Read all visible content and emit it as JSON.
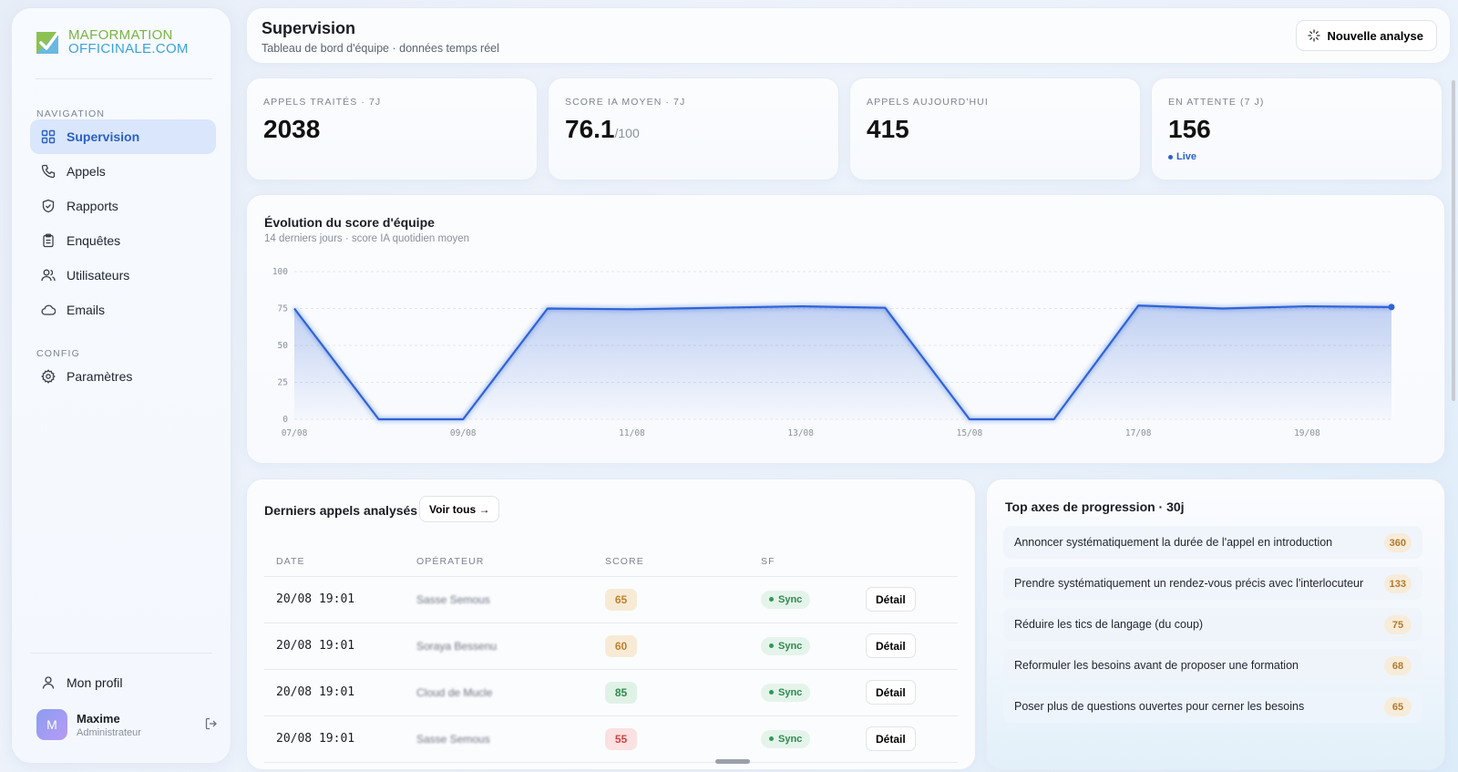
{
  "sidebar": {
    "logo": {
      "line1": "MAFORMATION",
      "line2": "OFFICINALE.COM"
    },
    "nav_section": "NAVIGATION",
    "config_section": "CONFIG",
    "items": [
      {
        "label": "Supervision",
        "icon": "grid-icon"
      },
      {
        "label": "Appels",
        "icon": "phone-icon"
      },
      {
        "label": "Rapports",
        "icon": "shield-icon"
      },
      {
        "label": "Enquêtes",
        "icon": "clipboard-icon"
      },
      {
        "label": "Utilisateurs",
        "icon": "users-icon"
      },
      {
        "label": "Emails",
        "icon": "cloud-icon"
      }
    ],
    "config_items": [
      {
        "label": "Paramètres",
        "icon": "gear-icon"
      }
    ],
    "profile_label": "Mon profil",
    "user": {
      "initial": "M",
      "name": "Maxime",
      "role": "Administrateur"
    }
  },
  "header": {
    "title": "Supervision",
    "subtitle": "Tableau de bord d'équipe · données temps réel",
    "new_analysis": "Nouvelle analyse"
  },
  "kpis": [
    {
      "label": "APPELS TRAITÉS · 7J",
      "value": "2038"
    },
    {
      "label": "SCORE IA MOYEN · 7J",
      "value": "76.1",
      "unit": "/100"
    },
    {
      "label": "APPELS AUJOURD'HUI",
      "value": "415"
    },
    {
      "label": "EN ATTENTE (7 J)",
      "value": "156",
      "live": "Live"
    }
  ],
  "chart": {
    "title": "Évolution du score d'équipe",
    "subtitle": "14 derniers jours · score IA quotidien moyen"
  },
  "chart_data": {
    "type": "area",
    "x": [
      "07/08",
      "08/08",
      "09/08",
      "10/08",
      "11/08",
      "12/08",
      "13/08",
      "14/08",
      "15/08",
      "16/08",
      "17/08",
      "18/08",
      "19/08",
      "20/08"
    ],
    "x_tick_labels": [
      "07/08",
      "09/08",
      "11/08",
      "13/08",
      "15/08",
      "17/08",
      "19/08"
    ],
    "series": [
      {
        "values": [
          75,
          0,
          0,
          75,
          74.5,
          75.5,
          76.5,
          75.5,
          0,
          0,
          77,
          75,
          76.5,
          76
        ]
      }
    ],
    "y_ticks": [
      0,
      25,
      50,
      75,
      100
    ],
    "ylim": [
      0,
      100
    ],
    "grid": true,
    "color": "#2f63d6"
  },
  "calls": {
    "title": "Derniers appels analysés",
    "see_all": "Voir tous →",
    "columns": [
      "DATE",
      "OPÉRATEUR",
      "SCORE",
      "SF"
    ],
    "detail_label": "Détail",
    "rows": [
      {
        "date": "20/08 19:01",
        "operator": "Sasse Semous",
        "score": "65",
        "score_color": "#f7ebd6",
        "score_text": "#c0822f",
        "sf": "Sync"
      },
      {
        "date": "20/08 19:01",
        "operator": "Soraya Bessenu",
        "score": "60",
        "score_color": "#f7ebd6",
        "score_text": "#c0822f",
        "sf": "Sync"
      },
      {
        "date": "20/08 19:01",
        "operator": "Cloud de Mucle",
        "score": "85",
        "score_color": "#e0f2e6",
        "score_text": "#2f8a4f",
        "sf": "Sync"
      },
      {
        "date": "20/08 19:01",
        "operator": "Sasse Semous",
        "score": "55",
        "score_color": "#fbe1e1",
        "score_text": "#cc4545",
        "sf": "Sync"
      }
    ]
  },
  "axes": {
    "title": "Top axes de progression · 30j",
    "items": [
      {
        "label": "Annoncer systématiquement la durée de l'appel en introduction",
        "count": "360"
      },
      {
        "label": "Prendre systématiquement un rendez-vous précis avec l'interlocuteur",
        "count": "133"
      },
      {
        "label": "Réduire les tics de langage (du coup)",
        "count": "75"
      },
      {
        "label": "Reformuler les besoins avant de proposer une formation",
        "count": "68"
      },
      {
        "label": "Poser plus de questions ouvertes pour cerner les besoins",
        "count": "65"
      }
    ]
  }
}
